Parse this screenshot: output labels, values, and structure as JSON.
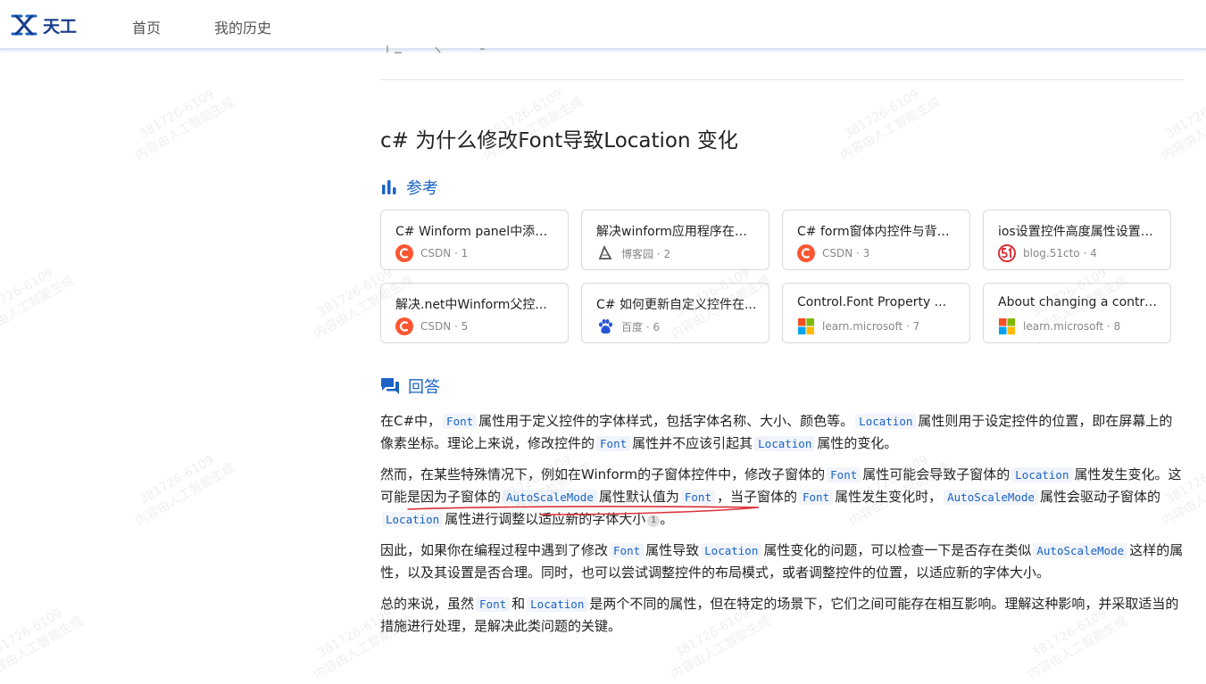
{
  "app": {
    "name": "天工"
  },
  "nav": {
    "home": "首页",
    "history": "我的历史"
  },
  "page": {
    "title": "c# 为什么修改Font导致Location 变化"
  },
  "references": {
    "heading": "参考",
    "items": [
      {
        "title": "C# Winform panel中添加...",
        "source": "CSDN · 1",
        "icon": "csdn-icon"
      },
      {
        "title": "解决winform应用程序在不...",
        "source": "博客园 · 2",
        "icon": "cnblogs-icon"
      },
      {
        "title": "C# form窗体内控件与背景...",
        "source": "CSDN · 3",
        "icon": "csdn-icon"
      },
      {
        "title": "ios设置控件高度属性设置控...",
        "source": "blog.51cto · 4",
        "icon": "51cto-icon"
      },
      {
        "title": "解决.net中Winform父控...",
        "source": "CSDN · 5",
        "icon": "csdn-icon"
      },
      {
        "title": "C# 如何更新自定义控件在...",
        "source": "百度 · 6",
        "icon": "baidu-icon"
      },
      {
        "title": "Control.Font Property ...",
        "source": "learn.microsoft · 7",
        "icon": "microsoft-icon"
      },
      {
        "title": "About changing a control'...",
        "source": "learn.microsoft · 8",
        "icon": "microsoft-icon"
      }
    ]
  },
  "answer": {
    "heading": "回答",
    "p1": {
      "t1": "在C#中，",
      "c1": "Font",
      "t2": "属性用于定义控件的字体样式，包括字体名称、大小、颜色等。",
      "c2": "Location",
      "t3": "属性则用于设定控件的位置，即在屏幕上的像素坐标。理论上来说，修改控件的",
      "c3": "Font",
      "t4": "属性并不应该引起其",
      "c4": "Location",
      "t5": "属性的变化。"
    },
    "p2": {
      "t1": "然而，在某些特殊情况下，例如在Winform的子窗体控件中，修改子窗体的",
      "c1": "Font",
      "t2": "属性可能会导致子窗体的",
      "c2": "Location",
      "t3": "属性发生变化。这可能是因为子窗体的",
      "c3": "AutoScaleMode",
      "t4": "属性默认值为",
      "c4": "Font",
      "t5": "，当子窗体的",
      "c5": "Font",
      "t6": "属性发生变化时，",
      "c6": "AutoScaleMode",
      "t7": "属性会驱动子窗体的",
      "c7": "Location",
      "t8": "属性进行调整以适应新的字体大小",
      "cite": "1",
      "t9": "。"
    },
    "p3": {
      "t1": "因此，如果你在编程过程中遇到了修改",
      "c1": "Font",
      "t2": "属性导致",
      "c2": "Location",
      "t3": "属性变化的问题，可以检查一下是否存在类似",
      "c3": "AutoScaleMode",
      "t4": "这样的属性，以及其设置是否合理。同时，也可以尝试调整控件的布局模式，或者调整控件的位置，以适应新的字体大小。"
    },
    "p4": {
      "t1": "总的来说，虽然",
      "c1": "Font",
      "t2": "和",
      "c2": "Location",
      "t3": "是两个不同的属性，但在特定的场景下，它们之间可能存在相互影响。理解这种影响，并采取适当的措施进行处理，是解决此类问题的关键。"
    }
  },
  "watermark": {
    "line1": "381726-6109",
    "line2": "内容由人工智能生成"
  },
  "colors": {
    "brand": "#163d8a",
    "accent": "#1a63c4",
    "csdn": "#fc5531",
    "annotation": "#d9323a"
  }
}
